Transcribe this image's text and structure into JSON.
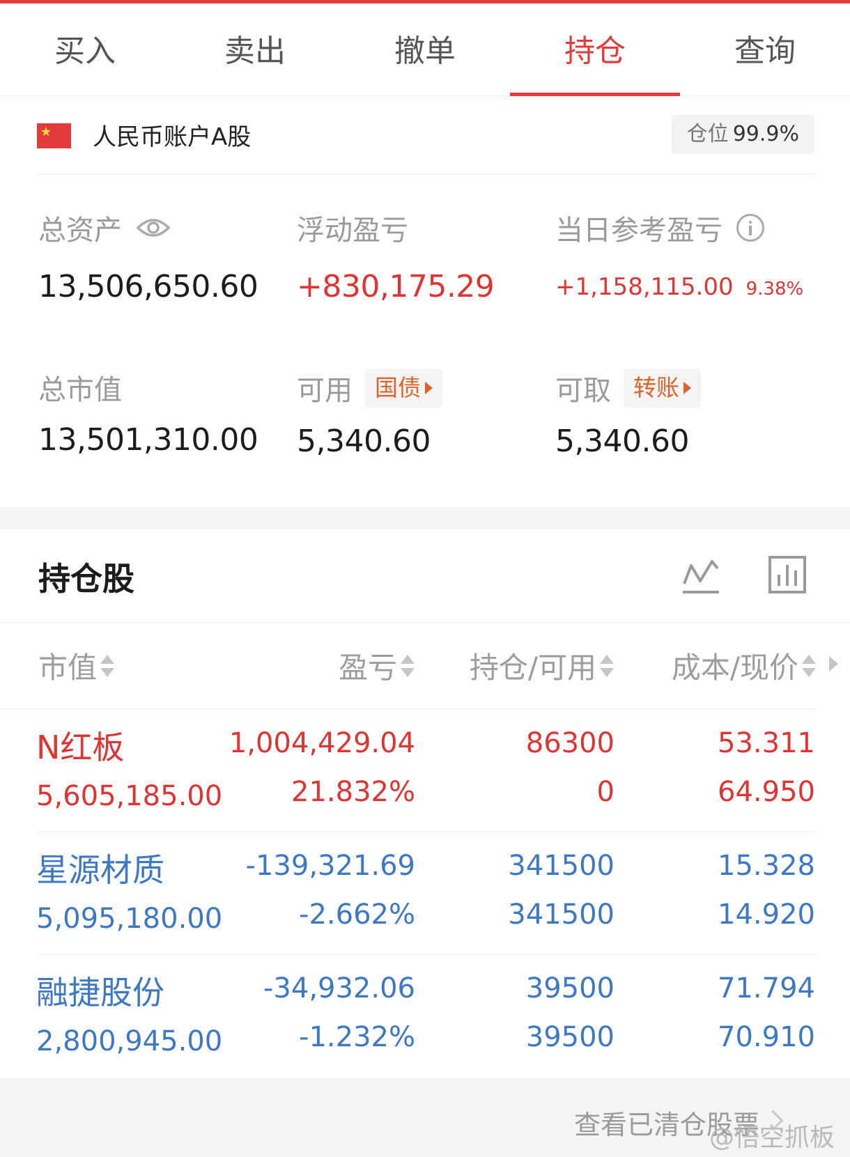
{
  "tabs": [
    {
      "label": "买入"
    },
    {
      "label": "卖出"
    },
    {
      "label": "撤单"
    },
    {
      "label": "持仓",
      "active": true
    },
    {
      "label": "查询"
    }
  ],
  "account": {
    "name": "人民币账户A股",
    "position_label": "仓位",
    "position_value": "99.9%"
  },
  "summary": {
    "total_assets_label": "总资产",
    "total_assets": "13,506,650.60",
    "floating_pl_label": "浮动盈亏",
    "floating_pl": "+830,175.29",
    "today_pl_label": "当日参考盈亏",
    "today_pl": "+1,158,115.00",
    "today_pl_pct": "9.38%",
    "market_value_label": "总市值",
    "market_value": "13,501,310.00",
    "available_label": "可用",
    "available_chip": "国债",
    "available": "5,340.60",
    "withdrawable_label": "可取",
    "withdrawable_chip": "转账",
    "withdrawable": "5,340.60"
  },
  "holdings": {
    "title": "持仓股",
    "columns": [
      "市值",
      "盈亏",
      "持仓/可用",
      "成本/现价"
    ],
    "rows": [
      {
        "name": "N红板",
        "market_value": "5,605,185.00",
        "pl": "1,004,429.04",
        "pl_pct": "21.832%",
        "position": "86300",
        "available": "0",
        "cost": "53.311",
        "price": "64.950",
        "color": "red"
      },
      {
        "name": "星源材质",
        "market_value": "5,095,180.00",
        "pl": "-139,321.69",
        "pl_pct": "-2.662%",
        "position": "341500",
        "available": "341500",
        "cost": "15.328",
        "price": "14.920",
        "color": "blue"
      },
      {
        "name": "融捷股份",
        "market_value": "2,800,945.00",
        "pl": "-34,932.06",
        "pl_pct": "-1.232%",
        "position": "39500",
        "available": "39500",
        "cost": "71.794",
        "price": "70.910",
        "color": "blue"
      }
    ]
  },
  "footer": {
    "link": "查看已清仓股票",
    "watermark": "@悟空抓板"
  },
  "colors": {
    "accent_red": "#e33b3b",
    "gain_red": "#df3434",
    "loss_blue": "#3f78c2",
    "chip_orange": "#e0622b"
  },
  "icons": [
    "eye-icon",
    "info-icon",
    "trend-line-icon",
    "bar-chart-icon",
    "sort-icon",
    "chevron-right-icon",
    "china-flag-icon"
  ]
}
